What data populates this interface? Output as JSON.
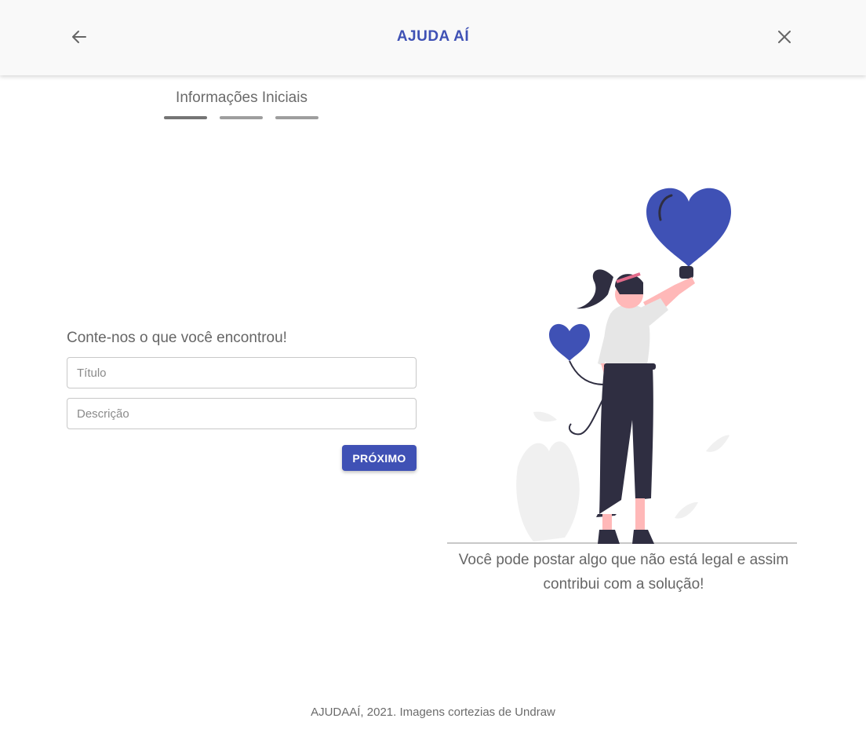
{
  "header": {
    "title": "AJUDA AÍ",
    "back_icon": "arrow-left-icon",
    "close_icon": "close-icon"
  },
  "stepper": {
    "title": "Informações Iniciais",
    "steps": [
      "step-1",
      "step-2",
      "step-3"
    ],
    "active_step": 1
  },
  "form": {
    "heading": "Conte-nos o que você encontrou!",
    "title_field": {
      "placeholder": "Título",
      "value": ""
    },
    "description_field": {
      "placeholder": "Descrição",
      "value": ""
    },
    "next_label": "PRÓXIMO"
  },
  "illustration": {
    "caption": "Você pode postar algo que não está legal e assim contribui com a solução!"
  },
  "footer": {
    "text": "AJUDAAÍ, 2021. Imagens cortezias de Undraw"
  },
  "colors": {
    "accent": "#3f51b5",
    "heart": "#3f51b5",
    "skin": "#ffb8b8",
    "pants": "#2f2e41"
  }
}
